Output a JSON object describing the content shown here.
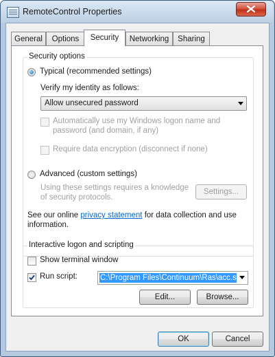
{
  "window": {
    "title": "RemoteControl Properties",
    "icon": "window-icon",
    "close_icon": "close-icon"
  },
  "tabs": [
    {
      "label": "General"
    },
    {
      "label": "Options"
    },
    {
      "label": "Security"
    },
    {
      "label": "Networking"
    },
    {
      "label": "Sharing"
    }
  ],
  "active_tab": "Security",
  "security_options": {
    "group_label": "Security options",
    "typical_radio": {
      "label": "Typical (recommended settings)",
      "checked": true
    },
    "verify_label": "Verify my identity as follows:",
    "verify_select": {
      "value": "Allow unsecured password"
    },
    "auto_logon_checkbox": {
      "line1": "Automatically use my Windows logon name and",
      "line2": "password (and domain, if any)",
      "checked": false,
      "enabled": false
    },
    "encryption_checkbox": {
      "label": "Require data encryption (disconnect if none)",
      "checked": false,
      "enabled": false
    },
    "advanced_radio": {
      "label": "Advanced (custom settings)",
      "checked": false
    },
    "advanced_note": {
      "line1": "Using these settings requires a knowledge",
      "line2": "of security protocols."
    },
    "settings_button": "Settings...",
    "privacy_text": {
      "before": "See our online ",
      "link": "privacy statement",
      "after": " for data collection and use",
      "line2": "information."
    }
  },
  "interactive": {
    "group_label": "Interactive logon and scripting",
    "show_terminal_checkbox": {
      "label": "Show terminal window",
      "checked": false
    },
    "run_script_checkbox": {
      "label": "Run script:",
      "checked": true
    },
    "script_path": "C:\\Program Files\\Continuum\\Ras\\acc.s",
    "edit_button": "Edit...",
    "browse_button": "Browse..."
  },
  "footer": {
    "ok_button": "OK",
    "cancel_button": "Cancel"
  },
  "colors": {
    "selection": "#3399ff",
    "link": "#0066cc",
    "close_button": "#c0301b"
  }
}
